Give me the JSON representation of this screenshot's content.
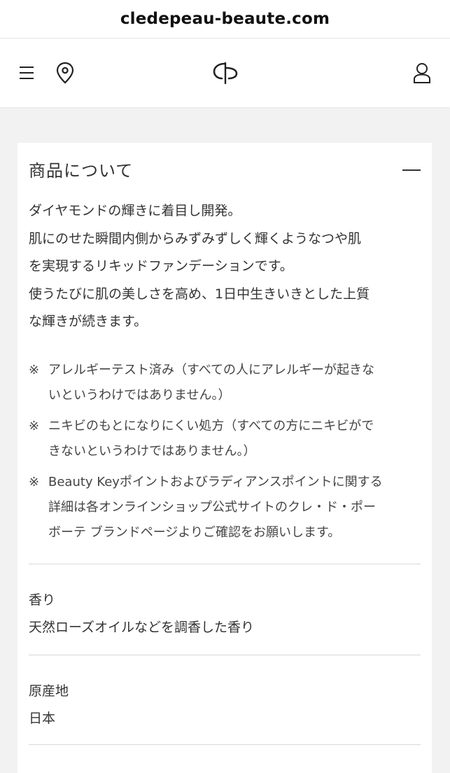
{
  "browser": {
    "url": "cledepeau-beaute.com"
  },
  "header": {
    "menu_icon": "hamburger-menu-icon",
    "store_icon": "location-pin-icon",
    "logo_icon": "cle-de-peau-logo",
    "account_icon": "user-account-icon"
  },
  "product_section": {
    "title": "商品について",
    "collapse_icon": "minus-icon",
    "description_lines": [
      "ダイヤモンドの輝きに着目し開発。",
      "肌にのせた瞬間内側からみずみずしく輝くようなつや肌",
      "を実現するリキッドファンデーションです。",
      "使うたびに肌の美しさを高め、1日中生きいきとした上質",
      "な輝きが続きます。"
    ],
    "notes": [
      {
        "mark": "※",
        "lines": [
          "アレルギーテスト済み（すべての人にアレルギーが起きな",
          "いというわけではありません。）"
        ]
      },
      {
        "mark": "※",
        "lines": [
          "ニキビのもとになりにくい処方（すべての方にニキビがで",
          "きないというわけではありません。）"
        ]
      },
      {
        "mark": "※",
        "lines": [
          "Beauty Keyポイントおよびラディアンスポイントに関する",
          "詳細は各オンラインショップ公式サイトのクレ・ド・ポー",
          "ボーテ ブランドページよりご確認をお願いします。"
        ]
      }
    ],
    "attributes": [
      {
        "label": "香り",
        "value": "天然ローズオイルなどを調香した香り"
      },
      {
        "label": "原産地",
        "value": "日本"
      }
    ]
  }
}
